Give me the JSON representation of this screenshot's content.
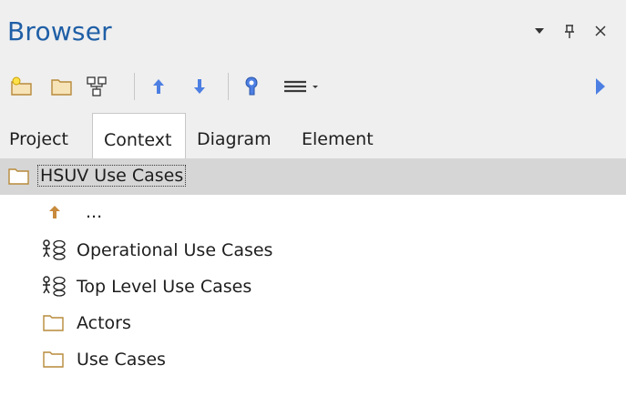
{
  "panel": {
    "title": "Browser",
    "title_color": "#1f5fa6",
    "controls": {
      "dropdown": "▾",
      "pin": "ᵖ",
      "close": "×"
    }
  },
  "toolbar": {
    "buttons": [
      {
        "name": "new-package-icon"
      },
      {
        "name": "folder-icon"
      },
      {
        "name": "diagram-icon"
      },
      {
        "name": "move-up-icon"
      },
      {
        "name": "move-down-icon"
      },
      {
        "name": "locate-icon"
      },
      {
        "name": "menu-icon"
      },
      {
        "name": "expand-right-icon"
      }
    ]
  },
  "tabs": [
    {
      "label": "Project",
      "active": false
    },
    {
      "label": "Context",
      "active": true
    },
    {
      "label": "Diagram",
      "active": false
    },
    {
      "label": "Element",
      "active": false
    }
  ],
  "tree": {
    "root": {
      "label": "HSUV Use Cases",
      "icon": "folder-icon",
      "selected": true
    },
    "items": [
      {
        "label": "...",
        "icon": "up-arrow-icon"
      },
      {
        "label": "Operational Use Cases",
        "icon": "use-case-diagram-icon"
      },
      {
        "label": "Top Level Use Cases",
        "icon": "use-case-diagram-icon"
      },
      {
        "label": "Actors",
        "icon": "folder-icon"
      },
      {
        "label": "Use Cases",
        "icon": "folder-icon"
      }
    ]
  },
  "colors": {
    "accent_blue": "#4d7fe3",
    "folder_stroke": "#b78a3a",
    "folder_fill": "#f7e3b8",
    "selected_row": "#d6d6d6",
    "arrow_orange": "#c88a3c"
  }
}
